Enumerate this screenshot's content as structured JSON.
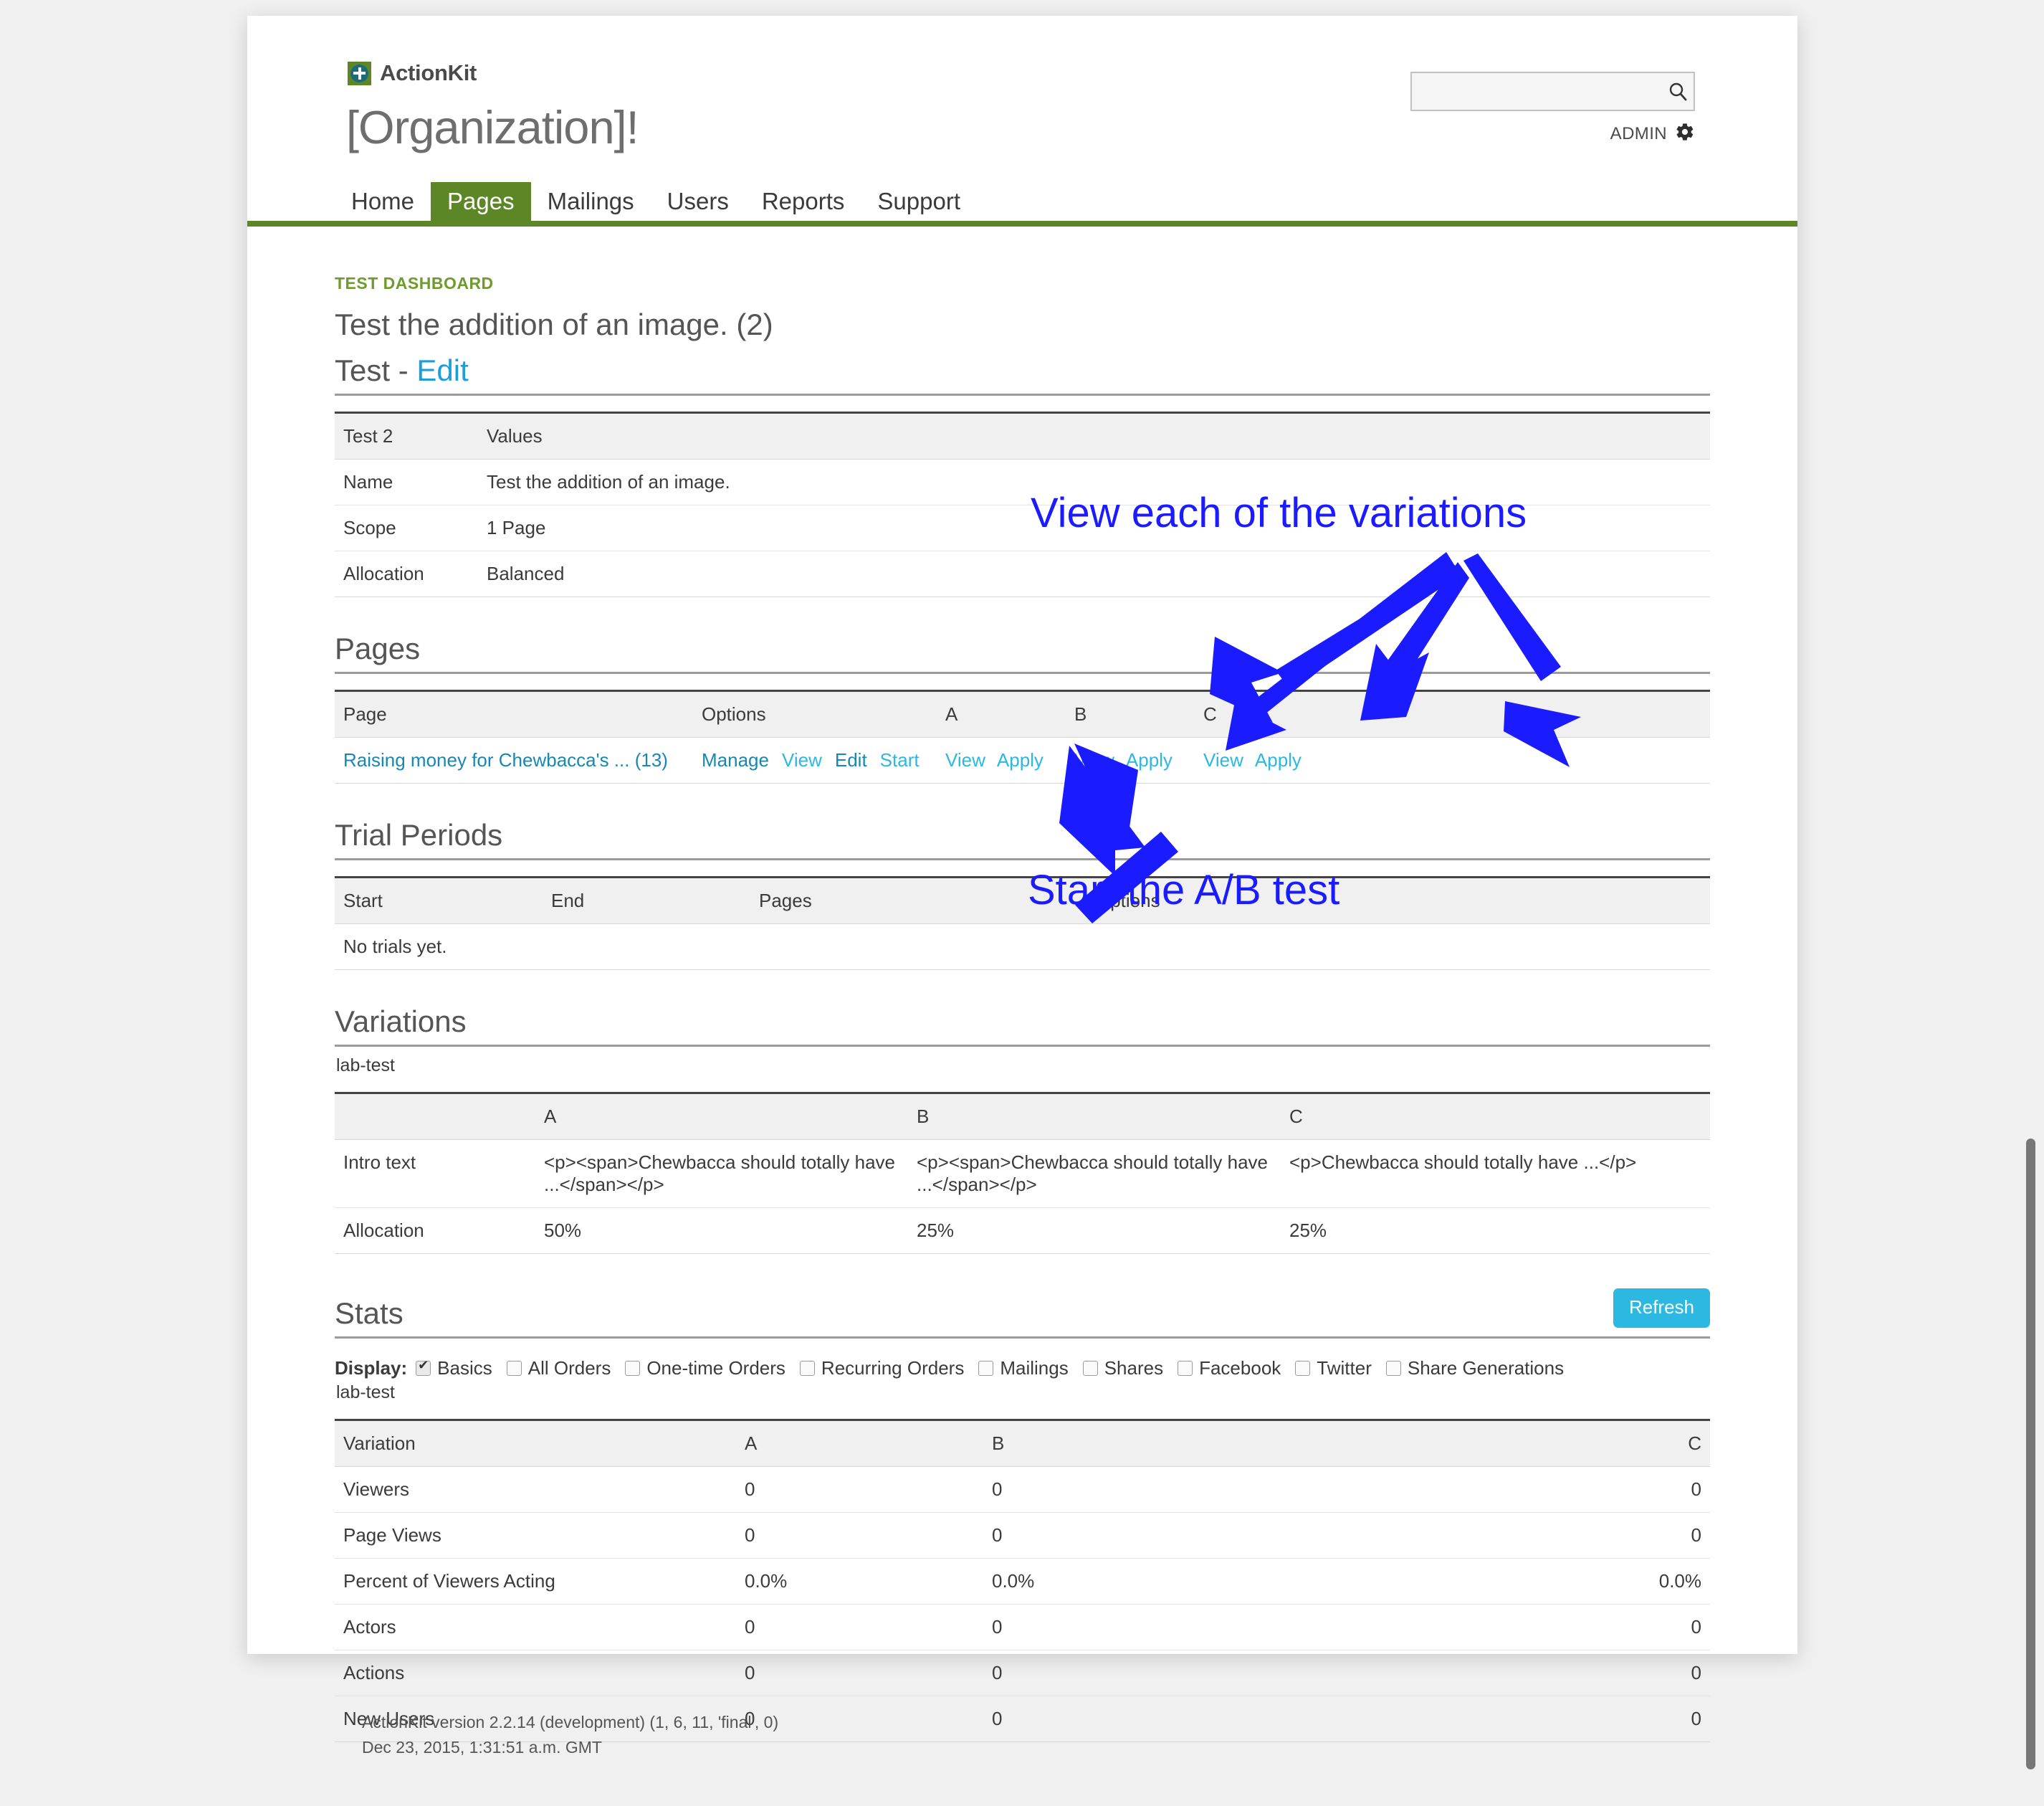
{
  "brand": {
    "name": "ActionKit",
    "logo_icon": "actionkit-plus-icon"
  },
  "header": {
    "org_title": "[Organization]!",
    "search": {
      "value": "",
      "placeholder": "",
      "icon": "search-icon"
    },
    "admin_label": "ADMIN",
    "gear_icon": "gear-icon"
  },
  "nav": {
    "items": [
      {
        "label": "Home",
        "active": false
      },
      {
        "label": "Pages",
        "active": true
      },
      {
        "label": "Mailings",
        "active": false
      },
      {
        "label": "Users",
        "active": false
      },
      {
        "label": "Reports",
        "active": false
      },
      {
        "label": "Support",
        "active": false
      }
    ],
    "accent_color": "#5d8727"
  },
  "breadcrumb": "TEST DASHBOARD",
  "page_title": "Test the addition of an image. (2)",
  "test_section": {
    "heading_prefix": "Test - ",
    "edit_label": "Edit",
    "table": {
      "headers": [
        "Test 2",
        "Values"
      ],
      "rows": [
        [
          "Name",
          "Test the addition of an image."
        ],
        [
          "Scope",
          "1 Page"
        ],
        [
          "Allocation",
          "Balanced"
        ]
      ]
    }
  },
  "pages_section": {
    "heading": "Pages",
    "headers": [
      "Page",
      "Options",
      "A",
      "B",
      "C"
    ],
    "row": {
      "page_link": "Raising money for Chewbacca's ... (13)",
      "options": [
        {
          "label": "Manage",
          "style": "dark"
        },
        {
          "label": "View",
          "style": "light"
        },
        {
          "label": "Edit",
          "style": "dark"
        },
        {
          "label": "Start",
          "style": "light"
        }
      ],
      "variant_a": [
        {
          "label": "View",
          "style": "light"
        },
        {
          "label": "Apply",
          "style": "light"
        }
      ],
      "variant_b": [
        {
          "label": "View",
          "style": "light"
        },
        {
          "label": "Apply",
          "style": "light"
        }
      ],
      "variant_c": [
        {
          "label": "View",
          "style": "light"
        },
        {
          "label": "Apply",
          "style": "light"
        }
      ]
    }
  },
  "trial_section": {
    "heading": "Trial Periods",
    "headers": [
      "Start",
      "End",
      "Pages",
      "Options"
    ],
    "empty_message": "No trials yet."
  },
  "variations_section": {
    "heading": "Variations",
    "sub_label": "lab-test",
    "headers": [
      "",
      "A",
      "B",
      "C"
    ],
    "rows": [
      {
        "label": "Intro text",
        "a": "<p><span>Chewbacca should totally have ...</span></p>",
        "b": "<p><span>Chewbacca should totally have ...</span></p>",
        "c": "<p>Chewbacca should totally have ...</p>"
      },
      {
        "label": "Allocation",
        "a": "50%",
        "b": "25%",
        "c": "25%"
      }
    ]
  },
  "stats_section": {
    "heading": "Stats",
    "refresh_label": "Refresh",
    "display_label": "Display:",
    "display_options": [
      {
        "label": "Basics",
        "checked": true
      },
      {
        "label": "All Orders",
        "checked": false
      },
      {
        "label": "One-time Orders",
        "checked": false
      },
      {
        "label": "Recurring Orders",
        "checked": false
      },
      {
        "label": "Mailings",
        "checked": false
      },
      {
        "label": "Shares",
        "checked": false
      },
      {
        "label": "Facebook",
        "checked": false
      },
      {
        "label": "Twitter",
        "checked": false
      },
      {
        "label": "Share Generations",
        "checked": false
      }
    ],
    "sub_label": "lab-test",
    "headers": [
      "Variation",
      "A",
      "B",
      "C"
    ],
    "rows": [
      {
        "label": "Viewers",
        "a": "0",
        "b": "0",
        "c": "0"
      },
      {
        "label": "Page Views",
        "a": "0",
        "b": "0",
        "c": "0"
      },
      {
        "label": "Percent of Viewers Acting",
        "a": "0.0%",
        "b": "0.0%",
        "c": "0.0%"
      },
      {
        "label": "Actors",
        "a": "0",
        "b": "0",
        "c": "0"
      },
      {
        "label": "Actions",
        "a": "0",
        "b": "0",
        "c": "0"
      },
      {
        "label": "New Users",
        "a": "0",
        "b": "0",
        "c": "0"
      }
    ]
  },
  "annotations": {
    "color": "#1b1bff",
    "note_variations": "View each of the variations",
    "note_start": "Start the A/B test"
  },
  "footer": {
    "version_line": "ActionKit version 2.2.14 (development) (1, 6, 11, 'final', 0)",
    "timestamp_line": "Dec 23, 2015, 1:31:51 a.m. GMT"
  }
}
